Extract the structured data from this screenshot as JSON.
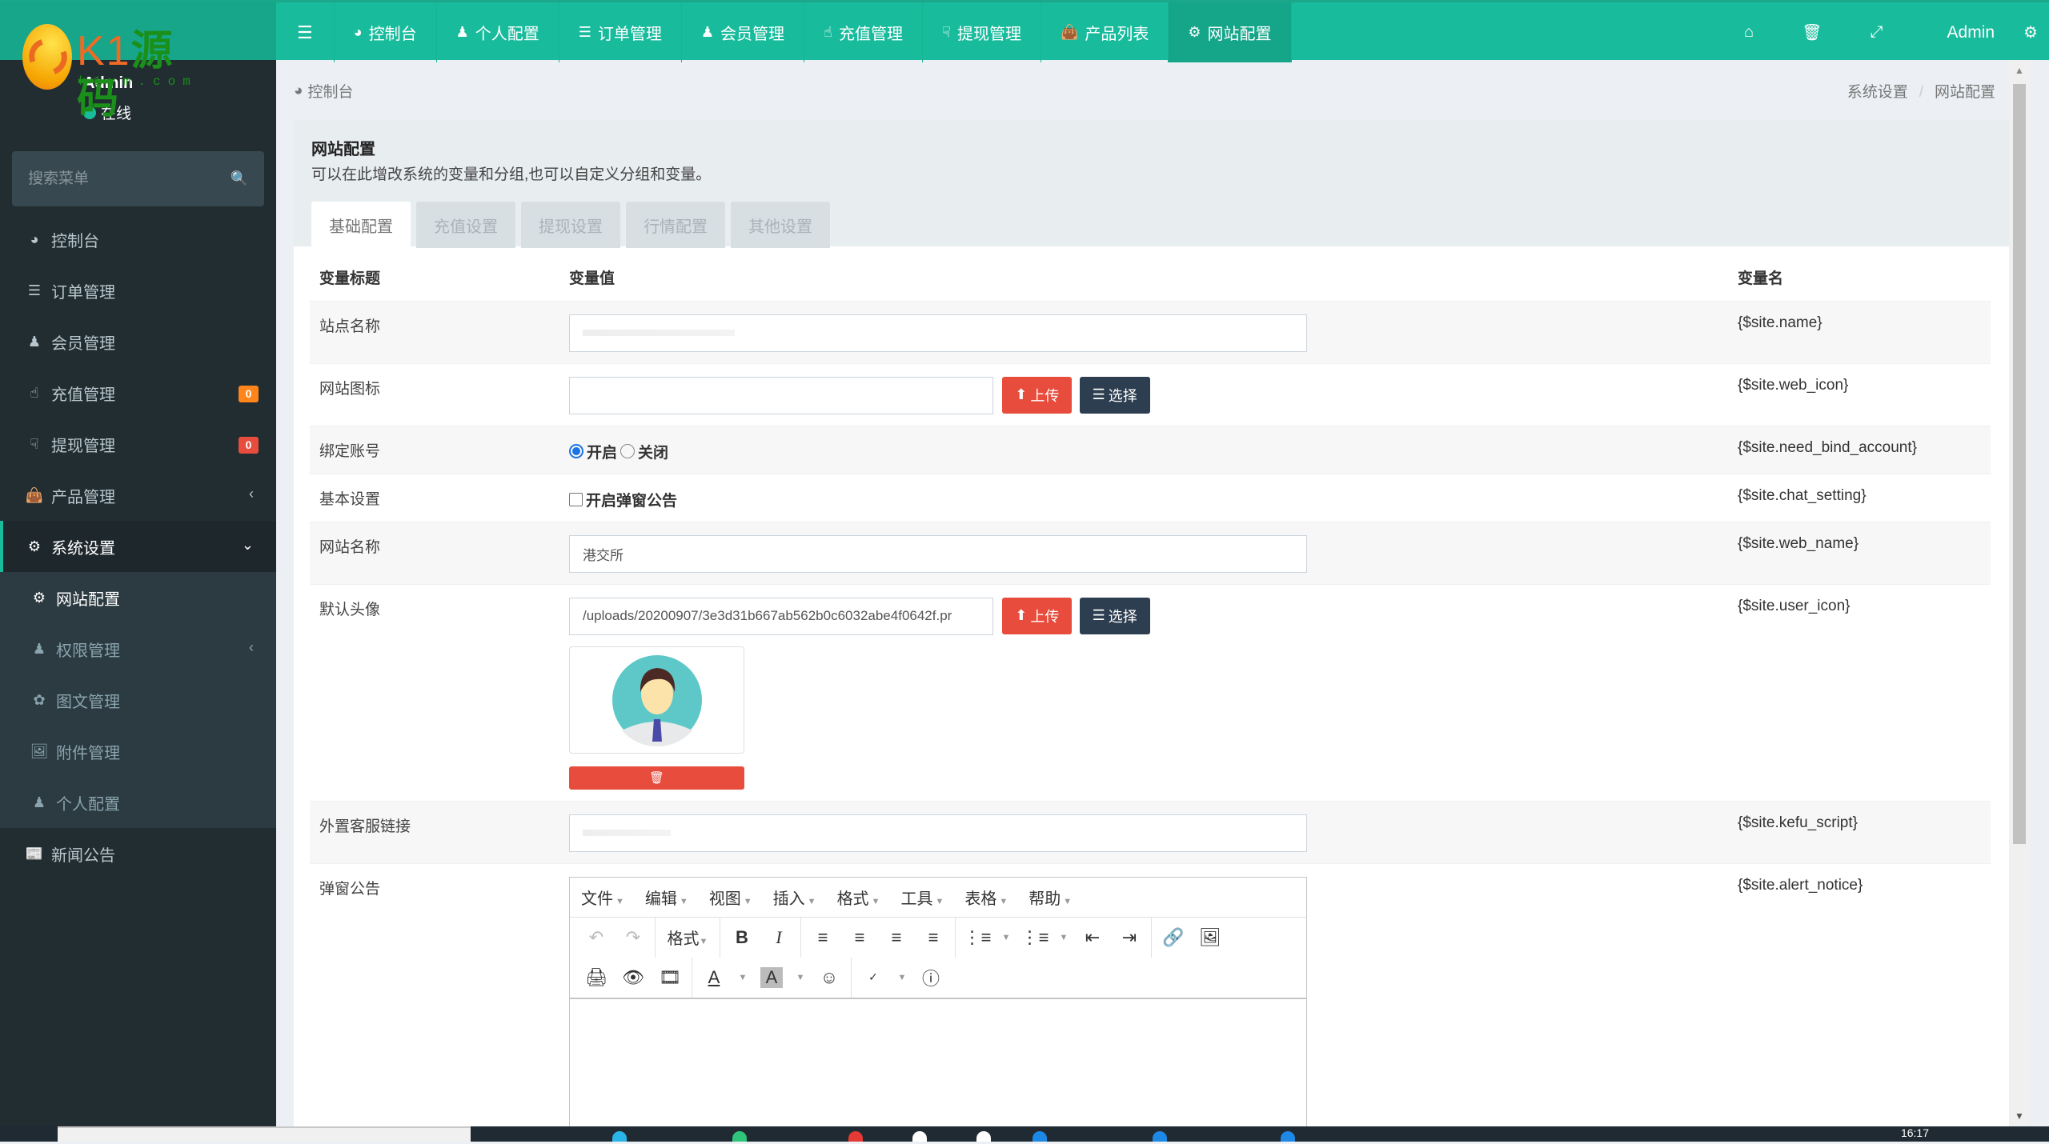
{
  "logo": {
    "brand": "K1",
    "brand_cn": "源码",
    "domain": "k1ym.com"
  },
  "user": {
    "name": "Admin",
    "status": "在线"
  },
  "search": {
    "placeholder": "搜索菜单"
  },
  "topnav": {
    "toggle_icon": "bars-icon",
    "items": [
      {
        "label": "控制台",
        "icon": "dashboard-icon",
        "active": false
      },
      {
        "label": "个人配置",
        "icon": "user-icon",
        "active": false
      },
      {
        "label": "订单管理",
        "icon": "list-ol-icon",
        "active": false
      },
      {
        "label": "会员管理",
        "icon": "users-icon",
        "active": false
      },
      {
        "label": "充值管理",
        "icon": "hand-pointer-icon",
        "active": false
      },
      {
        "label": "提现管理",
        "icon": "hand-down-icon",
        "active": false
      },
      {
        "label": "产品列表",
        "icon": "shopping-bag-icon",
        "active": false
      },
      {
        "label": "网站配置",
        "icon": "gear-icon",
        "active": true
      }
    ],
    "right": {
      "admin": "Admin"
    }
  },
  "sidebar": {
    "items": [
      {
        "label": "控制台",
        "icon": "dashboard-icon"
      },
      {
        "label": "订单管理",
        "icon": "list-ol-icon"
      },
      {
        "label": "会员管理",
        "icon": "users-icon"
      },
      {
        "label": "充值管理",
        "icon": "hand-pointer-icon",
        "badge": "0",
        "badge_color": "#ff851b"
      },
      {
        "label": "提现管理",
        "icon": "hand-down-icon",
        "badge": "0",
        "badge_color": "#e74c3c"
      },
      {
        "label": "产品管理",
        "icon": "shopping-bag-icon"
      },
      {
        "label": "系统设置",
        "icon": "cogs-icon"
      }
    ],
    "submenu": [
      {
        "label": "网站配置",
        "icon": "gear-icon"
      },
      {
        "label": "权限管理",
        "icon": "group-icon"
      },
      {
        "label": "图文管理",
        "icon": "leaf-icon"
      },
      {
        "label": "附件管理",
        "icon": "file-image-icon"
      },
      {
        "label": "个人配置",
        "icon": "user-icon"
      }
    ],
    "last": {
      "label": "新闻公告",
      "icon": "newspaper-icon"
    }
  },
  "breadcrumb": {
    "home": "控制台",
    "path": [
      "系统设置",
      "网站配置"
    ]
  },
  "panel": {
    "title": "网站配置",
    "description": "可以在此增改系统的变量和分组,也可以自定义分组和变量。",
    "tabs": [
      "基础配置",
      "充值设置",
      "提现设置",
      "行情配置",
      "其他设置"
    ],
    "active_tab": 0
  },
  "table": {
    "headers": [
      "变量标题",
      "变量值",
      "变量名"
    ],
    "rows": [
      {
        "title": "站点名称",
        "value": "",
        "var": "{$site.name}"
      },
      {
        "title": "网站图标",
        "value": "",
        "var": "{$site.web_icon}"
      },
      {
        "title": "绑定账号",
        "options": [
          "开启",
          "关闭"
        ],
        "selected": 0,
        "var": "{$site.need_bind_account}"
      },
      {
        "title": "基本设置",
        "checkbox_label": "开启弹窗公告",
        "checked": false,
        "var": "{$site.chat_setting}"
      },
      {
        "title": "网站名称",
        "value": "港交所",
        "var": "{$site.web_name}"
      },
      {
        "title": "默认头像",
        "value": "/uploads/20200907/3e3d31b667ab562b0c6032abe4f0642f.pr",
        "var": "{$site.user_icon}"
      },
      {
        "title": "外置客服链接",
        "value": "",
        "var": "{$site.kefu_script}"
      },
      {
        "title": "弹窗公告",
        "var": "{$site.alert_notice}"
      }
    ],
    "upload_label": "上传",
    "choose_label": "选择"
  },
  "editor": {
    "menus": [
      "文件",
      "编辑",
      "视图",
      "插入",
      "格式",
      "工具",
      "表格",
      "帮助"
    ],
    "format_label": "格式"
  },
  "taskbar": {
    "time": "16:17"
  }
}
